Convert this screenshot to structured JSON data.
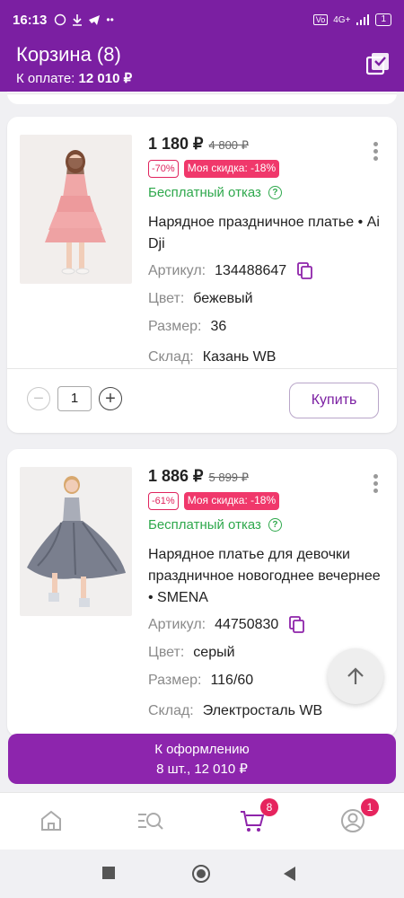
{
  "status_bar": {
    "time": "16:13",
    "network": "4G+",
    "battery": "1"
  },
  "header": {
    "title": "Корзина (8)",
    "payment_label": "К оплате:",
    "payment_amount": "12 010 ₽"
  },
  "products": [
    {
      "price": "1 180 ₽",
      "old_price": "4 800 ₽",
      "discount": "-70%",
      "my_discount": "Моя скидка: -18%",
      "free_return": "Бесплатный отказ",
      "name": "Нарядное праздничное платье • Ai Dji",
      "article_label": "Артикул:",
      "article": "134488647",
      "color_label": "Цвет:",
      "color": "бежевый",
      "size_label": "Размер:",
      "size": "36",
      "warehouse_label": "Склад:",
      "warehouse": "Казань WB",
      "quantity": "1",
      "buy_label": "Купить"
    },
    {
      "price": "1 886 ₽",
      "old_price": "5 899 ₽",
      "discount": "-61%",
      "my_discount": "Моя скидка: -18%",
      "free_return": "Бесплатный отказ",
      "name": "Нарядное платье для девочки праздничное новогоднее вечернее • SMENA",
      "article_label": "Артикул:",
      "article": "44750830",
      "color_label": "Цвет:",
      "color": "серый",
      "size_label": "Размер:",
      "size": "116/60",
      "warehouse_label": "Склад:",
      "warehouse": "Электросталь WB"
    }
  ],
  "checkout": {
    "label": "К оформлению",
    "summary": "8 шт., 12 010 ₽"
  },
  "tabbar": {
    "items": [
      {
        "icon": "home-icon"
      },
      {
        "icon": "catalog-search-icon"
      },
      {
        "icon": "cart-icon",
        "badge": "8"
      },
      {
        "icon": "profile-icon",
        "badge": "1"
      }
    ]
  },
  "colors": {
    "brand": "#7b1fa2",
    "checkout": "#8d25ad",
    "green": "#2ea84c",
    "pink": "#f0386b"
  }
}
